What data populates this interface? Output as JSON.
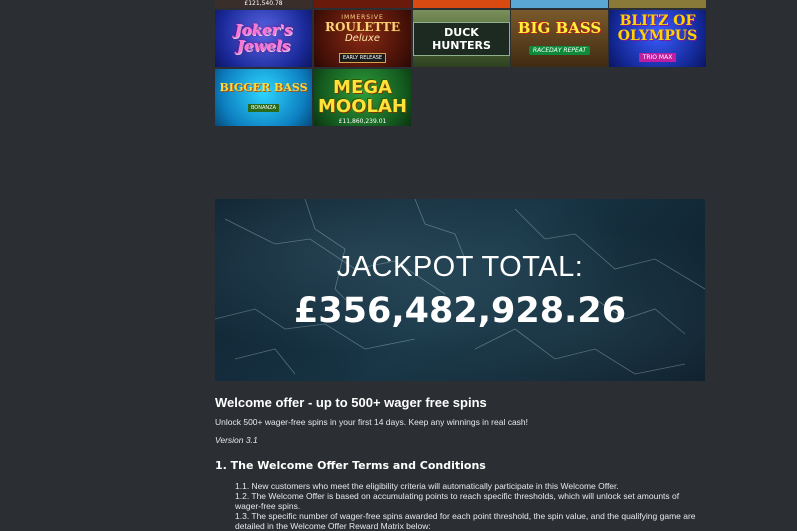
{
  "top_row_captions": [
    "£121,540.78"
  ],
  "games": [
    {
      "id": "jokers-jewels",
      "title": "Joker's Jewels"
    },
    {
      "id": "immersive-roulette",
      "sub": "IMMERSIVE",
      "title": "ROULETTE",
      "extra": "Deluxe",
      "badge": "EARLY RELEASE"
    },
    {
      "id": "duck-hunters",
      "title": "DUCK HUNTERS"
    },
    {
      "id": "big-bass",
      "title": "BIG BASS",
      "ribbon": "RACEDAY REPEAT"
    },
    {
      "id": "blitz-olympus",
      "title": "BLITZ OF OLYMPUS",
      "badge": "TRIO MAX"
    },
    {
      "id": "bigger-bass",
      "title": "BIGGER BASS",
      "ribbon": "BONANZA"
    },
    {
      "id": "mega-moolah",
      "title": "MEGA MOOLAH",
      "caption": "£11,860,239.01"
    }
  ],
  "jackpot": {
    "label": "JACKPOT TOTAL:",
    "amount": "£356,482,928.26"
  },
  "offer": {
    "title": "Welcome offer - up to 500+ wager free spins",
    "subtitle": "Unlock 500+ wager-free spins in your first 14 days. Keep any winnings in real cash!",
    "version": "Version 3.1"
  },
  "terms": {
    "heading": "1. The Welcome Offer Terms and Conditions",
    "items": [
      "1.1. New customers who meet the eligibility criteria will automatically participate in this Welcome Offer.",
      "1.2. The Welcome Offer is based on accumulating points to reach specific thresholds, which will unlock set amounts of wager-free spins.",
      "1.3. The specific number of wager-free spins awarded for each point threshold, the spin value, and the qualifying game are detailed in the Welcome Offer Reward Matrix below:"
    ]
  }
}
